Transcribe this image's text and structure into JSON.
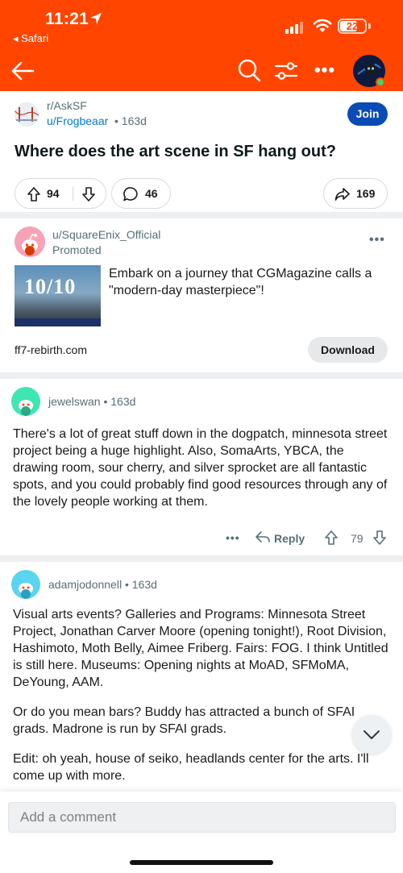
{
  "status_bar": {
    "time": "11:21",
    "back_app": "◂ Safari",
    "battery": "22"
  },
  "nav": {
    "icons": [
      "back-arrow-icon",
      "search-icon",
      "filter-icon",
      "more-icon",
      "user-avatar"
    ]
  },
  "colors": {
    "brand": "#ff4500",
    "join": "#0a4bb5",
    "link": "#0079d3",
    "muted": "#576f76"
  },
  "post": {
    "subreddit": "r/AskSF",
    "author": "u/Frogbeaar",
    "age": "• 163d",
    "join_label": "Join",
    "title": "Where does the art scene in SF hang out?",
    "upvotes": "94",
    "comments": "46",
    "shares": "169"
  },
  "promo": {
    "user": "u/SquareEnix_Official",
    "label": "Promoted",
    "image_score": "10/10",
    "text": "Embark on a journey that CGMagazine calls a \"modern-day masterpiece\"!",
    "domain": "ff7-rebirth.com",
    "cta": "Download"
  },
  "comments": [
    {
      "user": "jewelswan",
      "age": "• 163d",
      "paragraphs": [
        "There's a lot of great stuff down in the dogpatch, minnesota street project being a huge highlight. Also, SomaArts, YBCA, the drawing room, sour cherry, and silver sprocket are all fantastic spots, and you could probably find good resources through any of the lovely people working at them."
      ],
      "reply_label": "Reply",
      "score": "79"
    },
    {
      "user": "adamjodonnell",
      "age": "• 163d",
      "paragraphs": [
        "Visual arts events? Galleries and Programs: Minnesota Street Project, Jonathan Carver Moore (opening tonight!), Root Division, Hashimoto, Moth Belly, Aimee Friberg. Fairs: FOG. I think Untitled is still here. Museums: Opening nights at MoAD, SFMoMA, DeYoung, AAM.",
        "Or do you mean bars? Buddy has attracted a bunch of SFAI grads. Madrone is run by SFAI grads.",
        "Edit: oh yeah, house of seiko, headlands center for the arts. I'll come up with more."
      ]
    }
  ],
  "composer": {
    "placeholder": "Add a comment"
  }
}
